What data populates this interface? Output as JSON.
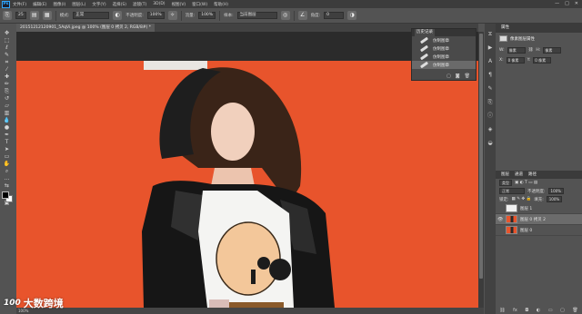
{
  "app": {
    "logo": "Ps",
    "menu": [
      "文件(F)",
      "编辑(E)",
      "图像(I)",
      "图层(L)",
      "文字(Y)",
      "选择(S)",
      "滤镜(T)",
      "3D(D)",
      "视图(V)",
      "窗口(W)",
      "帮助(H)"
    ],
    "window_controls": [
      "—",
      "□",
      "✕"
    ]
  },
  "options": {
    "size_value": "25",
    "mode_label": "模式:",
    "mode_value": "正常",
    "opacity_label": "不透明度:",
    "opacity_value": "100%",
    "flow_label": "流量:",
    "flow_value": "100%",
    "sample_label": "样本:",
    "sample_value": "当前图层",
    "angle_label": "角度:",
    "angle_value": "0"
  },
  "document": {
    "tab_label": "20151212120901_5AqVi.jpeg @ 100% (图层 0 拷贝 2, RGB/8#) *",
    "status_zoom": "100%"
  },
  "history": {
    "tab": "历史记录",
    "items": [
      "仿制图章",
      "仿制图章",
      "仿制图章",
      "仿制图章"
    ],
    "active_index": 3
  },
  "properties": {
    "tabs": [
      "属性"
    ],
    "title": "像素图层属性",
    "w_label": "W:",
    "w_value": "像素",
    "h_label": "H:",
    "h_value": "像素",
    "x_label": "X:",
    "x_value": "0 像素",
    "y_label": "Y:",
    "y_value": "0 像素"
  },
  "layers": {
    "tabs": [
      "图层",
      "通道",
      "路径"
    ],
    "kind_label": "类型",
    "blend_mode": "正常",
    "opacity_label": "不透明度:",
    "opacity_value": "100%",
    "lock_label": "锁定:",
    "fill_label": "填充:",
    "fill_value": "100%",
    "items": [
      {
        "name": "图层 1",
        "thumb": "white",
        "visible": false,
        "selected": false
      },
      {
        "name": "图层 0 拷贝 2",
        "thumb": "orange",
        "visible": true,
        "selected": true
      },
      {
        "name": "图层 0",
        "thumb": "orange",
        "visible": false,
        "selected": false
      }
    ]
  },
  "watermark": {
    "badge": "100",
    "text": "大数跨境"
  },
  "colors": {
    "background_orange": "#e8542c",
    "ui_gray": "#535353",
    "ui_dark": "#3c3c3c"
  }
}
